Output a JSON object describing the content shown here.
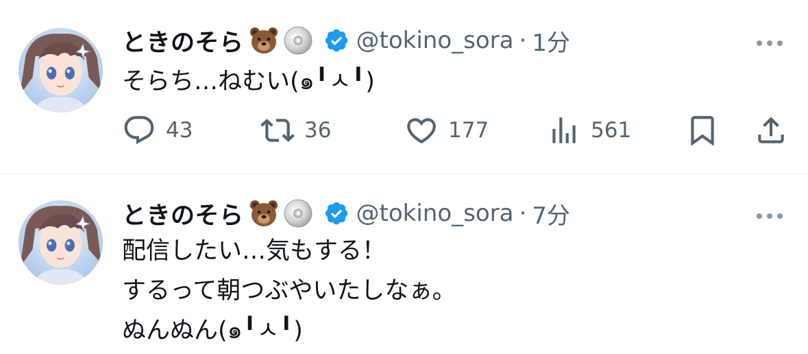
{
  "tweets": [
    {
      "display_name": "ときのそら",
      "handle": "@tokino_sora",
      "separator": "·",
      "time": "1分",
      "text": "そらち…ねむい(๑╹ㅅ╹)",
      "reply_count": "43",
      "retweet_count": "36",
      "like_count": "177",
      "view_count": "561"
    },
    {
      "display_name": "ときのそら",
      "handle": "@tokino_sora",
      "separator": "·",
      "time": "7分",
      "text": "配信したい…気もする！\nするって朝つぶやいたしなぁ。\nぬんぬん(๑╹ㅅ╹)"
    }
  ],
  "colors": {
    "text_primary": "#0f1419",
    "text_secondary": "#536471",
    "verified_blue": "#1d9bf0",
    "divider": "#e6e9ec"
  },
  "icons": [
    "reply-icon",
    "retweet-icon",
    "like-icon",
    "views-icon",
    "bookmark-icon",
    "share-icon",
    "more-icon",
    "verified-icon",
    "bear-emoji",
    "disc-emoji"
  ]
}
